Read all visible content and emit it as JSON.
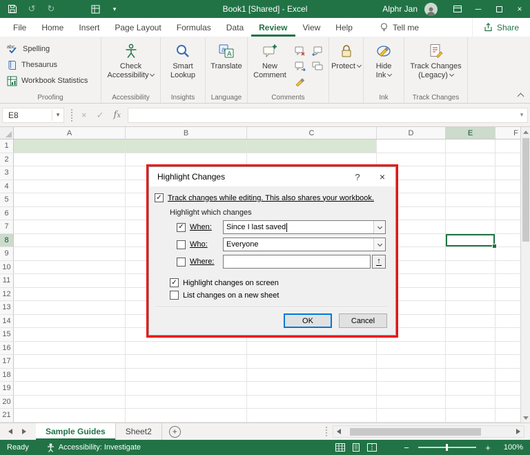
{
  "colors": {
    "excel_green": "#217346",
    "row_highlight_fill": "#d9e6d3",
    "annotation_red": "#ee1111",
    "ok_focus_blue": "#0078d7"
  },
  "title_bar": {
    "title": "Book1 [Shared] - Excel",
    "user_name": "Alphr Jan"
  },
  "ribbon_tabs": [
    {
      "label": "File",
      "active": false
    },
    {
      "label": "Home",
      "active": false
    },
    {
      "label": "Insert",
      "active": false
    },
    {
      "label": "Page Layout",
      "active": false
    },
    {
      "label": "Formulas",
      "active": false
    },
    {
      "label": "Data",
      "active": false
    },
    {
      "label": "Review",
      "active": true
    },
    {
      "label": "View",
      "active": false
    },
    {
      "label": "Help",
      "active": false
    }
  ],
  "tab_row": {
    "tell_me": "Tell me",
    "share": "Share"
  },
  "ribbon": {
    "proofing": {
      "label": "Proofing",
      "spelling": "Spelling",
      "thesaurus": "Thesaurus",
      "workbook_statistics": "Workbook Statistics"
    },
    "accessibility": {
      "label": "Accessibility",
      "line1": "Check",
      "line2": "Accessibility"
    },
    "insights": {
      "label": "Insights",
      "line1": "Smart",
      "line2": "Lookup"
    },
    "language": {
      "label": "Language",
      "line1": "Translate",
      "line2": ""
    },
    "comments": {
      "label": "Comments",
      "line1": "New",
      "line2": "Comment"
    },
    "protect": {
      "label": "",
      "line1": "Protect",
      "line2": ""
    },
    "ink": {
      "label": "Ink",
      "line1": "Hide",
      "line2": "Ink"
    },
    "track_changes": {
      "label": "Track Changes",
      "line1": "Track Changes",
      "line2": "(Legacy)"
    }
  },
  "formula_bar": {
    "name_box": "E8",
    "formula": ""
  },
  "grid": {
    "columns": [
      "A",
      "B",
      "C",
      "D",
      "E",
      "F"
    ],
    "row_numbers": [
      1,
      2,
      3,
      4,
      5,
      6,
      7,
      8,
      9,
      10,
      11,
      12,
      13,
      14,
      15,
      16,
      17,
      18,
      19,
      20,
      21
    ],
    "selected_cell": "E8",
    "selected_column": "E",
    "selected_row": "8",
    "highlighted_cells": [
      "A1",
      "B1",
      "C1"
    ]
  },
  "dialog": {
    "title": "Highlight Changes",
    "help": "?",
    "track_label": "Track changes while editing. This also shares your workbook.",
    "track_checked": true,
    "section_label": "Highlight which changes",
    "when_label": "When:",
    "when_checked": true,
    "when_value": "Since I last saved",
    "who_label": "Who:",
    "who_checked": false,
    "who_value": "Everyone",
    "where_label": "Where:",
    "where_checked": false,
    "where_value": "",
    "opt_screen_label": "Highlight changes on screen",
    "opt_screen_checked": true,
    "opt_sheet_label": "List changes on a new sheet",
    "opt_sheet_checked": false,
    "ok": "OK",
    "cancel": "Cancel"
  },
  "sheet_tabs": [
    {
      "label": "Sample Guides",
      "active": true
    },
    {
      "label": "Sheet2",
      "active": false
    }
  ],
  "status_bar": {
    "mode": "Ready",
    "accessibility": "Accessibility: Investigate",
    "zoom": "100%"
  }
}
